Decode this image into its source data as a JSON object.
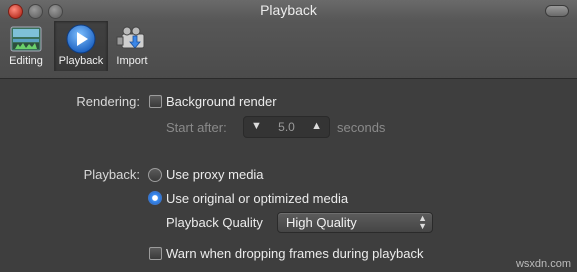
{
  "window": {
    "title": "Playback"
  },
  "toolbar": {
    "items": [
      {
        "label": "Editing",
        "icon": "editing-icon"
      },
      {
        "label": "Playback",
        "icon": "playback-icon",
        "selected": true
      },
      {
        "label": "Import",
        "icon": "import-icon"
      }
    ]
  },
  "rendering": {
    "label": "Rendering:",
    "background_render": {
      "label": "Background render",
      "checked": false
    },
    "start_after": {
      "label": "Start after:",
      "value": "5.0",
      "unit": "seconds",
      "enabled": false
    }
  },
  "playback": {
    "label": "Playback:",
    "options": [
      {
        "label": "Use proxy media",
        "selected": false
      },
      {
        "label": "Use original or optimized media",
        "selected": true
      }
    ],
    "quality": {
      "label": "Playback Quality",
      "value": "High Quality"
    },
    "warn_dropping": {
      "label": "Warn when dropping frames during playback",
      "checked": false
    }
  },
  "watermark": "wsxdn.com",
  "colors": {
    "accent": "#3f8ef0",
    "background": "#3e3e3e"
  }
}
